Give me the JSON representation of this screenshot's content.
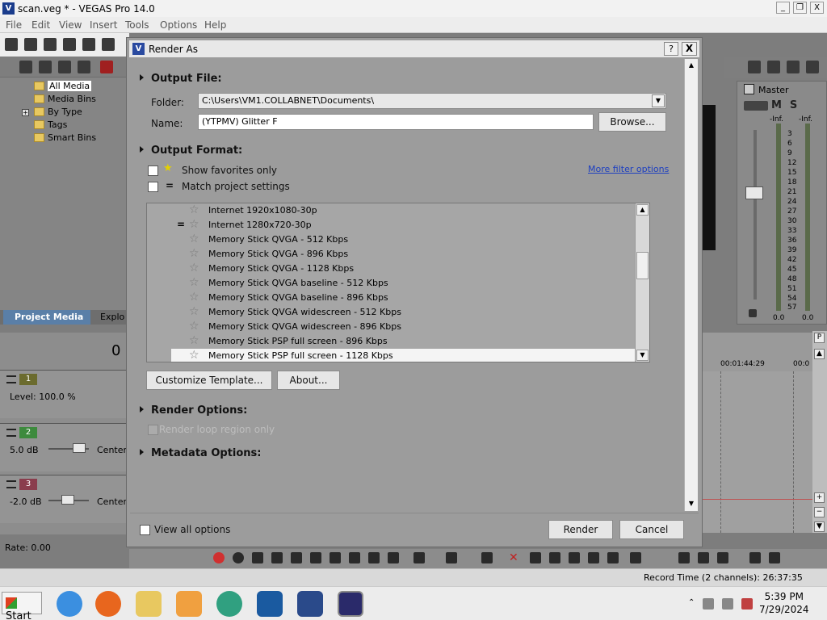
{
  "app": {
    "title": "scan.veg * - VEGAS Pro 14.0",
    "icon_letter": "V",
    "window_buttons": [
      "_",
      "❐",
      "X"
    ]
  },
  "menu": [
    "File",
    "Edit",
    "View",
    "Insert",
    "Tools",
    "Options",
    "Help"
  ],
  "media_tree": {
    "items": [
      {
        "label": "All Media",
        "selected": true
      },
      {
        "label": "Media Bins"
      },
      {
        "label": "By Type"
      },
      {
        "label": "Tags"
      },
      {
        "label": "Smart Bins"
      }
    ]
  },
  "panel_tabs": {
    "active": "Project Media",
    "other": "Explo"
  },
  "tracks": [
    {
      "number": "1",
      "level": "Level: 100.0 %",
      "center": ""
    },
    {
      "number": "2",
      "level": "5.0 dB",
      "center": "Center"
    },
    {
      "number": "3",
      "level": "-2.0 dB",
      "center": "Center"
    }
  ],
  "time_partial": "0",
  "rate": "Rate: 0.00",
  "master": {
    "title": "Master",
    "ms": "MS",
    "inf_left": "-Inf.",
    "inf_right": "-Inf.",
    "scale": [
      "3",
      "6",
      "9",
      "12",
      "15",
      "18",
      "21",
      "24",
      "27",
      "30",
      "33",
      "36",
      "39",
      "42",
      "45",
      "48",
      "51",
      "54",
      "57"
    ],
    "value_left": "0.0",
    "value_right": "0.0"
  },
  "timeline": {
    "time1": "00:01:44:29",
    "time2": "00:0"
  },
  "status": {
    "record_time": "Record Time (2 channels): 26:37:35"
  },
  "taskbar": {
    "start": "Start",
    "time": "5:39 PM",
    "date": "7/29/2024"
  },
  "dialog": {
    "title": "Render As",
    "help_btn": "?",
    "close_btn": "X",
    "output_file": {
      "heading": "Output File:",
      "folder_label": "Folder:",
      "folder_value": "C:\\Users\\VM1.COLLABNET\\Documents\\",
      "name_label": "Name:",
      "name_value": "(YTPMV) Glitter F",
      "browse": "Browse..."
    },
    "output_format": {
      "heading": "Output Format:",
      "show_favorites": "Show favorites only",
      "match_project": "Match project settings",
      "more_filter": "More filter options"
    },
    "templates": [
      {
        "name": "Internet 1920x1080-30p",
        "match": false,
        "selected": false
      },
      {
        "name": "Internet 1280x720-30p",
        "match": true,
        "selected": false
      },
      {
        "name": "Memory Stick QVGA - 512 Kbps",
        "match": false,
        "selected": false
      },
      {
        "name": "Memory Stick QVGA - 896 Kbps",
        "match": false,
        "selected": false
      },
      {
        "name": "Memory Stick QVGA - 1128 Kbps",
        "match": false,
        "selected": false
      },
      {
        "name": "Memory Stick QVGA baseline - 512 Kbps",
        "match": false,
        "selected": false
      },
      {
        "name": "Memory Stick QVGA baseline - 896 Kbps",
        "match": false,
        "selected": false
      },
      {
        "name": "Memory Stick QVGA widescreen - 512 Kbps",
        "match": false,
        "selected": false
      },
      {
        "name": "Memory Stick QVGA widescreen - 896 Kbps",
        "match": false,
        "selected": false
      },
      {
        "name": "Memory Stick PSP full screen - 896 Kbps",
        "match": false,
        "selected": false
      },
      {
        "name": "Memory Stick PSP full screen - 1128 Kbps",
        "match": false,
        "selected": true
      }
    ],
    "customize_template": "Customize Template...",
    "about": "About...",
    "render_options": {
      "heading": "Render Options:",
      "loop_region": "Render loop region only"
    },
    "metadata_options": {
      "heading": "Metadata Options:"
    },
    "view_all": "View all options",
    "render": "Render",
    "cancel": "Cancel"
  }
}
